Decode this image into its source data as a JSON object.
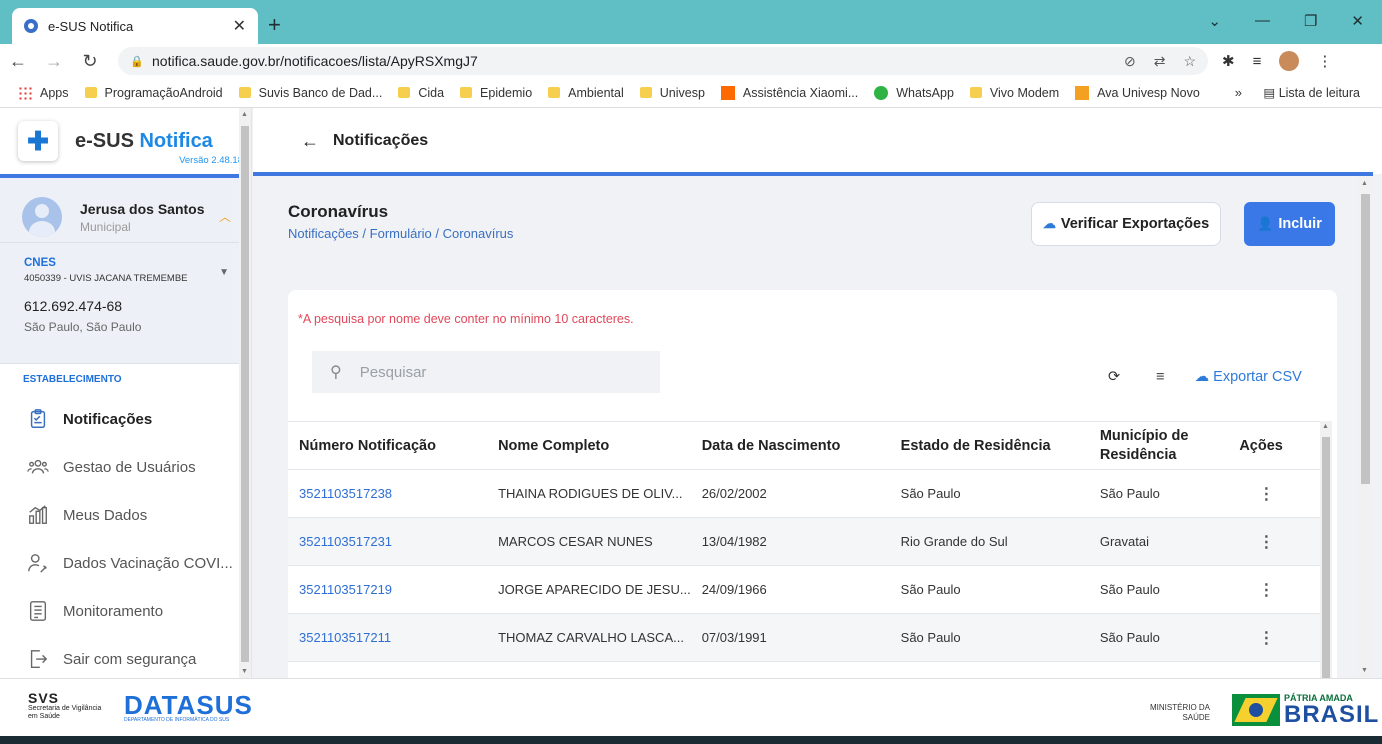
{
  "browser": {
    "tab_title": "e-SUS Notifica",
    "tab_close": "✕",
    "new_tab": "+",
    "url": "notifica.saude.gov.br/notificacoes/lista/ApyRSXmgJ7",
    "bookmarks": [
      {
        "label": "Apps",
        "icon": "apps-icon"
      },
      {
        "label": "ProgramaçãoAndroid",
        "icon": "folder-icon"
      },
      {
        "label": "Suvis Banco de Dad...",
        "icon": "folder-icon"
      },
      {
        "label": "Cida",
        "icon": "folder-icon"
      },
      {
        "label": "Epidemio",
        "icon": "folder-icon"
      },
      {
        "label": "Ambiental",
        "icon": "folder-icon"
      },
      {
        "label": "Univesp",
        "icon": "folder-icon"
      },
      {
        "label": "Assistência Xiaomi...",
        "icon": "xiaomi-icon"
      },
      {
        "label": "WhatsApp",
        "icon": "whatsapp-icon"
      },
      {
        "label": "Vivo Modem",
        "icon": "folder-icon"
      },
      {
        "label": "Ava Univesp Novo",
        "icon": "pencil-icon"
      }
    ],
    "bookmarks_more": "»",
    "reading_list": "Lista de leitura"
  },
  "sidebar": {
    "app_name_prefix": "e-SUS",
    "app_name_suffix": "Notifica",
    "version": "Versão 2.48.18",
    "user_name": "Jerusa dos Santos",
    "user_role": "Municipal",
    "cnes_label": "CNES",
    "cnes_value": "4050339 - UVIS JACANA TREMEMBE",
    "phone": "612.692.474-68",
    "city": "São Paulo, São Paulo",
    "section_label": "ESTABELECIMENTO",
    "menu": [
      {
        "label": "Notificações",
        "icon": "clipboard-icon",
        "active": true
      },
      {
        "label": "Gestao de Usuários",
        "icon": "users-icon"
      },
      {
        "label": "Meus Dados",
        "icon": "chart-icon"
      },
      {
        "label": "Dados Vacinação COVI...",
        "icon": "user-syringe-icon"
      },
      {
        "label": "Monitoramento",
        "icon": "monitor-list-icon"
      },
      {
        "label": "Sair com segurança",
        "icon": "logout-icon"
      }
    ]
  },
  "header": {
    "title": "Notificações"
  },
  "page": {
    "title": "Coronavírus",
    "breadcrumb": "Notificações / Formulário / Coronavírus",
    "verify_button": "Verificar Exportações",
    "include_button": "Incluir",
    "warning": "*A pesquisa por nome deve conter no mínimo 10 caracteres.",
    "search_placeholder": "Pesquisar",
    "export_csv": "Exportar CSV"
  },
  "table": {
    "columns": [
      "Número Notificação",
      "Nome Completo",
      "Data de Nascimento",
      "Estado de Residência",
      "Município de Residência",
      "Ações"
    ],
    "rows": [
      [
        "3521103517238",
        "THAINA RODIGUES DE OLIV...",
        "26/02/2002",
        "São Paulo",
        "São Paulo",
        "⋮"
      ],
      [
        "3521103517231",
        "MARCOS CESAR NUNES",
        "13/04/1982",
        "Rio Grande do Sul",
        "Gravatai",
        "⋮"
      ],
      [
        "3521103517219",
        "JORGE APARECIDO DE JESU...",
        "24/09/1966",
        "São Paulo",
        "São Paulo",
        "⋮"
      ],
      [
        "3521103517211",
        "THOMAZ CARVALHO LASCA...",
        "07/03/1991",
        "São Paulo",
        "São Paulo",
        "⋮"
      ]
    ]
  },
  "footer": {
    "svs_logo": "SVS",
    "svs_text": "Secretaria de Vigilância em Saúde",
    "datasus": "DATASUS",
    "datasus_sub": "DEPARTAMENTO DE INFORMÁTICA DO SUS",
    "ministry_line1": "MINISTÉRIO DA",
    "ministry_line2": "SAÚDE",
    "patria": "PÁTRIA AMADA",
    "brasil": "BRASIL"
  },
  "colors": {
    "accent": "#3a78e8",
    "tabbar": "#5fbfc4",
    "link": "#2e6ed6",
    "warning": "#e0485a"
  }
}
